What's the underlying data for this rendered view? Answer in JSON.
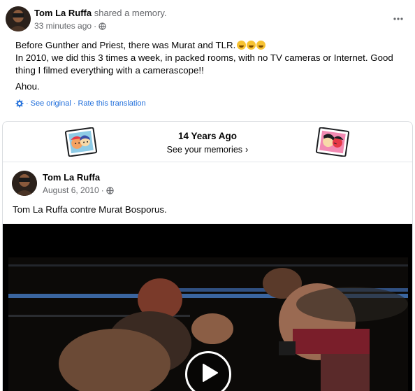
{
  "post": {
    "author": "Tom La Ruffa",
    "action": "shared a memory.",
    "timestamp": "33 minutes ago",
    "lines": [
      "Before Gunther and Priest, there was Murat and TLR.",
      "In 2010, we did this 3 times a week, in packed rooms, with no TV cameras or Internet. Good thing I filmed everything with a camerascope!!"
    ],
    "signoff": "Ahou.",
    "see_original": "See original",
    "rate_translation": "Rate this translation",
    "separator": "·"
  },
  "memory": {
    "years_ago": "14 Years Ago",
    "see_memories": "See your memories",
    "chevron": "›"
  },
  "original_post": {
    "author": "Tom La Ruffa",
    "date": "August 6, 2010",
    "text": "Tom La Ruffa contre Murat Bosporus."
  },
  "icons": {
    "more": "more-options-icon",
    "globe": "globe-icon",
    "gear": "gear-icon",
    "play": "play-icon"
  },
  "colors": {
    "link": "#216fdb",
    "secondary_text": "#65676b"
  }
}
